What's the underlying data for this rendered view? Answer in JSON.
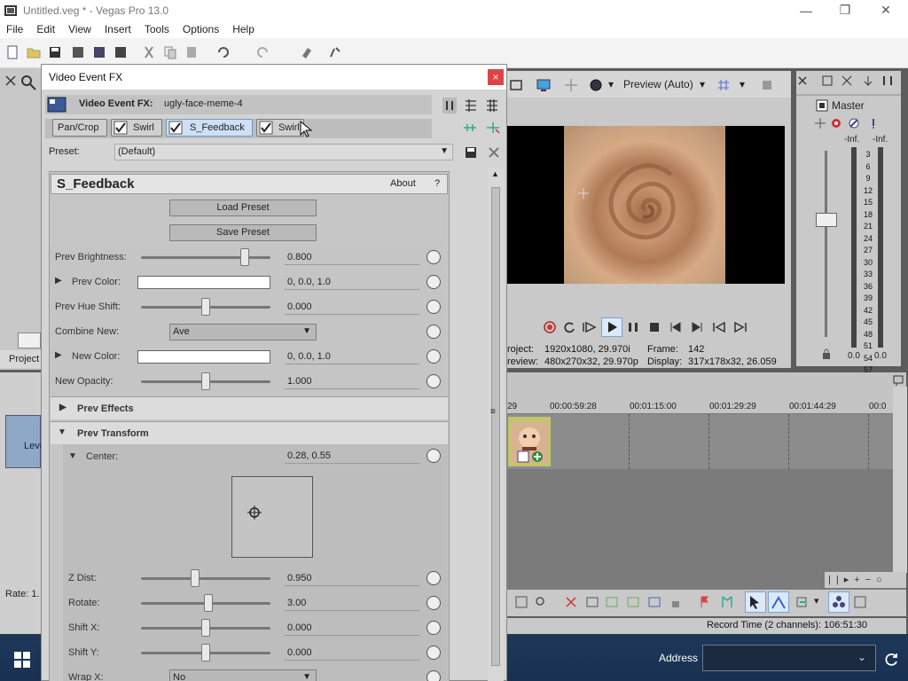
{
  "app": {
    "title": "Untitled.veg * - Vegas Pro 13.0"
  },
  "menu": [
    "File",
    "Edit",
    "View",
    "Insert",
    "Tools",
    "Options",
    "Help"
  ],
  "left_panel": {
    "project_tab": "Project",
    "rate": "Rate: 1.",
    "level": "Leve"
  },
  "dialog": {
    "title": "Video Event FX",
    "close": "×",
    "event_label": "Video Event FX:",
    "event_name": "ugly-face-meme-4",
    "tabs": [
      "Pan/Crop",
      "Swirl",
      "S_Feedback",
      "Swirl"
    ],
    "preset_label": "Preset:",
    "preset_value": "(Default)",
    "plugin_name": "S_Feedback",
    "about": "About",
    "help": "?",
    "load_preset": "Load Preset",
    "save_preset": "Save Preset",
    "prev_brightness": {
      "label": "Prev Brightness:",
      "value": "0.800",
      "level": 0.8
    },
    "prev_color": {
      "label": "Prev Color:",
      "value": "0, 0.0, 1.0"
    },
    "prev_hue": {
      "label": "Prev Hue Shift:",
      "value": "0.000",
      "level": 0.5
    },
    "combine_new": {
      "label": "Combine New:",
      "value": "Ave"
    },
    "new_color": {
      "label": "New Color:",
      "value": "0, 0.0, 1.0"
    },
    "new_opacity": {
      "label": "New Opacity:",
      "value": "1.000",
      "level": 0.5
    },
    "prev_effects": "Prev Effects",
    "prev_transform": "Prev Transform",
    "center": {
      "label": "Center:",
      "value": "0.28, 0.55"
    },
    "zdist": {
      "label": "Z Dist:",
      "value": "0.950",
      "level": 0.42
    },
    "rotate": {
      "label": "Rotate:",
      "value": "3.00",
      "level": 0.52
    },
    "shiftx": {
      "label": "Shift X:",
      "value": "0.000",
      "level": 0.5
    },
    "shifty": {
      "label": "Shift Y:",
      "value": "0.000",
      "level": 0.5
    },
    "wrapx": {
      "label": "Wrap X:",
      "value": "No"
    }
  },
  "preview": {
    "mode": "Preview (Auto)",
    "project_label": "roject:",
    "project_value": "1920x1080, 29.970i",
    "preview_label": "review:",
    "preview_value": "480x270x32, 29.970p",
    "frame_label": "Frame:",
    "frame_value": "142",
    "display_label": "Display:",
    "display_value": "317x178x32, 26.059"
  },
  "mixer": {
    "title": "Master",
    "inf_left": "-Inf.",
    "inf_right": "-Inf.",
    "scale": [
      "3",
      "6",
      "9",
      "12",
      "15",
      "18",
      "21",
      "24",
      "27",
      "30",
      "33",
      "36",
      "39",
      "42",
      "45",
      "48",
      "51",
      "54",
      "57"
    ],
    "bottom_left": "0.0",
    "bottom_right": "0.0"
  },
  "timeline": {
    "ticks": [
      "29",
      "00:00:59:28",
      "00:01:15:00",
      "00:01:29:29",
      "00:01:44:29",
      "00:0"
    ]
  },
  "status": {
    "record_time": "Record Time (2 channels): 106:51:30"
  },
  "taskbar": {
    "address_label": "Address"
  },
  "colors": {
    "accent": "#3c78d8",
    "close": "#e04343"
  }
}
